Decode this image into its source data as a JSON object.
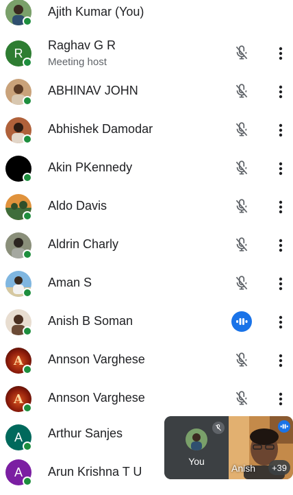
{
  "participants": [
    {
      "name": "Ajith Kumar (You)",
      "subtitle": "",
      "avatar": "photo-person",
      "status": "self"
    },
    {
      "name": "Raghav G R",
      "subtitle": "Meeting host",
      "avatar_letter": "R",
      "avatar_color": "#2e7d32",
      "status": "muted"
    },
    {
      "name": "ABHINAV JOHN",
      "subtitle": "",
      "avatar": "photo-person",
      "status": "muted"
    },
    {
      "name": "Abhishek Damodar",
      "subtitle": "",
      "avatar": "photo-person",
      "status": "muted"
    },
    {
      "name": "Akin PKennedy",
      "subtitle": "",
      "avatar": "black",
      "status": "muted"
    },
    {
      "name": "Aldo Davis",
      "subtitle": "",
      "avatar": "photo-landscape",
      "status": "muted"
    },
    {
      "name": "Aldrin Charly",
      "subtitle": "",
      "avatar": "photo-person",
      "status": "muted"
    },
    {
      "name": "Aman S",
      "subtitle": "",
      "avatar": "photo-person",
      "status": "muted"
    },
    {
      "name": "Anish B Soman",
      "subtitle": "",
      "avatar": "photo-person",
      "status": "speaking"
    },
    {
      "name": "Annson Varghese",
      "subtitle": "",
      "avatar_letter": "A",
      "avatar_style": "logo",
      "status": "muted"
    },
    {
      "name": "Annson Varghese",
      "subtitle": "",
      "avatar_letter": "A",
      "avatar_style": "logo",
      "status": "muted"
    },
    {
      "name": "Arthur Sanjes",
      "subtitle": "",
      "avatar_letter": "A",
      "avatar_color": "#00695c",
      "status": "none"
    },
    {
      "name": "Arun Krishna T U",
      "subtitle": "",
      "avatar_letter": "A",
      "avatar_color": "#7b1fa2",
      "status": "none"
    }
  ],
  "pip": {
    "self_label": "You",
    "other_label": "Anish",
    "more_count": "+39"
  },
  "colors": {
    "online": "#1e8e3e",
    "speaking": "#1a73e8",
    "muted_icon": "#5f6368"
  }
}
